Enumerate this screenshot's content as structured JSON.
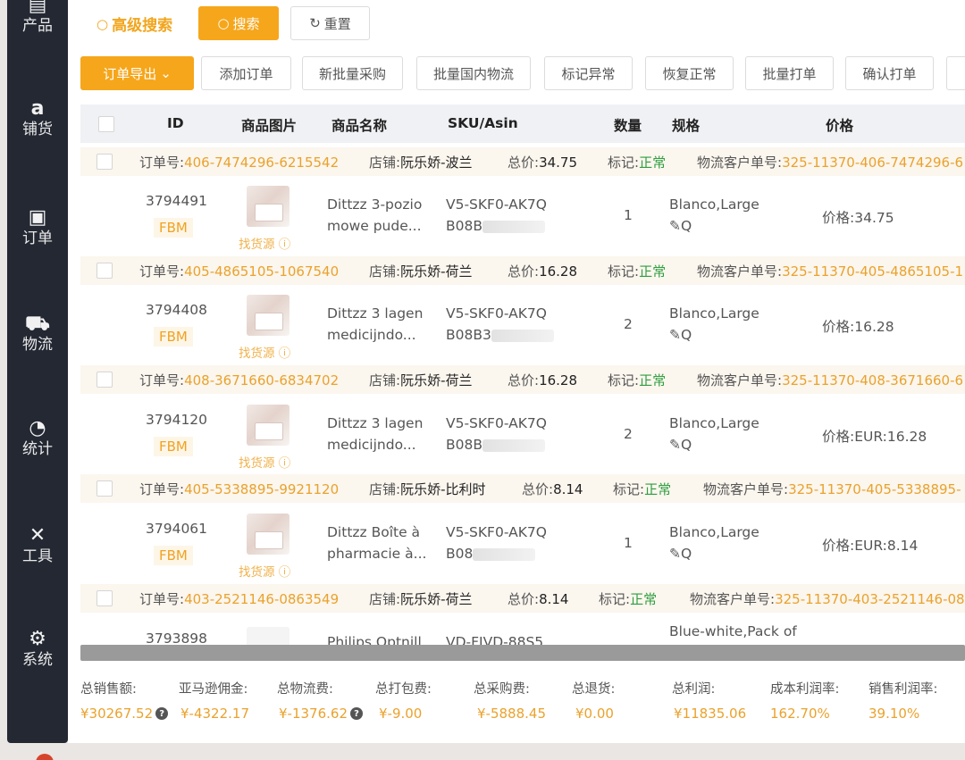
{
  "sidebar": {
    "items": [
      {
        "label": "产品",
        "icon": "product-icon",
        "glyph": "▤"
      },
      {
        "label": "铺货",
        "icon": "amazon-icon",
        "glyph": "a"
      },
      {
        "label": "订单",
        "icon": "order-icon",
        "glyph": "▣"
      },
      {
        "label": "物流",
        "icon": "truck-icon",
        "glyph": "⛟"
      },
      {
        "label": "统计",
        "icon": "pie-chart-icon",
        "glyph": "◔"
      },
      {
        "label": "工具",
        "icon": "tools-icon",
        "glyph": "✕"
      },
      {
        "label": "系统",
        "icon": "gear-icon",
        "glyph": "⚙"
      }
    ]
  },
  "search": {
    "advanced_label": "高级搜索",
    "search_label": "搜索",
    "reset_label": "重置"
  },
  "toolbar": {
    "export_label": "订单导出",
    "buttons": [
      "添加订单",
      "新批量采购",
      "批量国内物流",
      "标记异常",
      "恢复正常",
      "批量打单",
      "确认打单"
    ]
  },
  "table": {
    "columns": [
      "ID",
      "商品图片",
      "商品名称",
      "SKU/Asin",
      "数量",
      "规格",
      "价格"
    ]
  },
  "labels": {
    "order_no": "订单号:",
    "store": "店铺:",
    "total": "总价:",
    "mark": "标记:",
    "logistics_no": "物流客户单号:",
    "find_source": "找货源",
    "spec_icons": "✎Q"
  },
  "orders": [
    {
      "order_no": "406-7474296-6215542",
      "store": "阮乐娇-波兰",
      "total": "34.75",
      "mark": "正常",
      "logistics": "325-11370-406-7474296-6",
      "id": "3794491",
      "tag": "FBM",
      "name1": "Dittzz 3-pozio",
      "name2": "mowe pude...",
      "sku": "V5-SKF0-AK7Q",
      "asin": "B08B",
      "qty": "1",
      "spec": "Blanco,Large",
      "price": "价格:34.75"
    },
    {
      "order_no": "405-4865105-1067540",
      "store": "阮乐娇-荷兰",
      "total": "16.28",
      "mark": "正常",
      "logistics": "325-11370-405-4865105-1",
      "id": "3794408",
      "tag": "FBM",
      "name1": "Dittzz 3 lagen",
      "name2": "medicijndo...",
      "sku": "V5-SKF0-AK7Q",
      "asin": "B08B3",
      "qty": "2",
      "spec": "Blanco,Large",
      "price": "价格:16.28"
    },
    {
      "order_no": "408-3671660-6834702",
      "store": "阮乐娇-荷兰",
      "total": "16.28",
      "mark": "正常",
      "logistics": "325-11370-408-3671660-6",
      "id": "3794120",
      "tag": "FBM",
      "name1": "Dittzz 3 lagen",
      "name2": "medicijndo...",
      "sku": "V5-SKF0-AK7Q",
      "asin": "B08B",
      "qty": "2",
      "spec": "Blanco,Large",
      "price": "价格:EUR:16.28"
    },
    {
      "order_no": "405-5338895-9921120",
      "store": "阮乐娇-比利时",
      "total": "8.14",
      "mark": "正常",
      "logistics": "325-11370-405-5338895-",
      "id": "3794061",
      "tag": "FBM",
      "name1": "Dittzz Boîte à",
      "name2": "pharmacie à...",
      "sku": "V5-SKF0-AK7Q",
      "asin": "B08",
      "qty": "1",
      "spec": "Blanco,Large",
      "price": "价格:EUR:8.14"
    },
    {
      "order_no": "403-2521146-0863549",
      "store": "阮乐娇-荷兰",
      "total": "8.14",
      "mark": "正常",
      "logistics": "325-11370-403-2521146-08",
      "id": "3793898",
      "tag": "",
      "name1": "Philips Optnill",
      "name2": "",
      "sku": "VD-FIVD-88S5",
      "asin": "",
      "qty": "",
      "spec": "Blue-white,Pack of",
      "price": ""
    }
  ],
  "summary": {
    "items": [
      {
        "label": "总销售额:",
        "value": "¥30267.52",
        "help": true
      },
      {
        "label": "亚马逊佣金:",
        "value": "¥-4322.17",
        "help": false
      },
      {
        "label": "总物流费:",
        "value": "¥-1376.62",
        "help": true
      },
      {
        "label": "总打包费:",
        "value": "¥-9.00",
        "help": false
      },
      {
        "label": "总采购费:",
        "value": "¥-5888.45",
        "help": false
      },
      {
        "label": "总退货:",
        "value": "¥0.00",
        "help": false
      },
      {
        "label": "总利润:",
        "value": "¥11835.06",
        "help": false
      },
      {
        "label": "成本利润率:",
        "value": "162.70%",
        "help": false
      },
      {
        "label": "销售利润率:",
        "value": "39.10%",
        "help": false
      }
    ]
  },
  "colors": {
    "accent": "#f6a61b",
    "sidebar": "#232833",
    "normal": "#2e9e40"
  }
}
